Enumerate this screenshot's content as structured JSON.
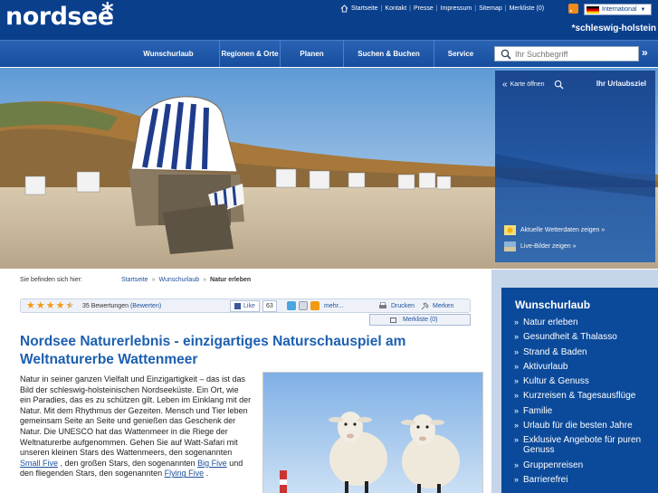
{
  "header": {
    "logo": "nordsee",
    "logo_star": "*",
    "tagline": "*schleswig-holstein",
    "top_links": [
      "Startseite",
      "Kontakt",
      "Presse",
      "Impressum",
      "Sitemap",
      "Merkliste (0)"
    ],
    "international": "International"
  },
  "nav": {
    "items": [
      "Wunschurlaub",
      "Regionen & Orte",
      "Planen",
      "Suchen & Buchen",
      "Service"
    ],
    "search_placeholder": "Ihr Suchbegriff",
    "search_go": "»"
  },
  "map_panel": {
    "open": "Karte öffnen",
    "title": "Ihr Urlaubsziel",
    "weather": "Aktuelle Wetterdaten zeigen »",
    "live": "Live-Bilder zeigen »"
  },
  "breadcrumb": {
    "label": "Sie befinden sich hier:",
    "items": [
      "Startseite",
      "Wunschurlaub"
    ],
    "current": "Natur erleben"
  },
  "toolbar": {
    "rating": 4.5,
    "ratings_text": "35 Bewertungen",
    "rate_link": "(Bewerten)",
    "like": "Like",
    "like_count": "63",
    "more": "mehr...",
    "print": "Drucken",
    "merken": "Merken",
    "merkliste": "Merkliste (0)"
  },
  "article": {
    "title": "Nordsee Naturerlebnis - einzigartiges Naturschauspiel am Weltnaturerbe Wattenmeer",
    "p1": "Natur in seiner ganzen Vielfalt und Einzigartigkeit – das ist das Bild der schleswig-holsteinischen Nordseeküste. Ein Ort, wie ein Paradies, das es zu schützen gilt. Leben im Einklang mit der Natur. Mit dem Rhythmus der Gezeiten. Mensch und Tier leben gemeinsam Seite an Seite und genießen das Geschenk der Natur. Die UNESCO hat das Wattenmeer in die Riege der Weltnaturerbe aufgenommen. Gehen Sie auf Watt-Safari mit unseren kleinen Stars des Wattenmeers, den sogenannten",
    "link1": "Small Five",
    "p2": ", den großen Stars, den sogenannten",
    "link2": "Big Five",
    "p3": "und den fliegenden Stars, den sogenannten",
    "link3": "Flying Five",
    "p4": "."
  },
  "sidebar": {
    "title": "Wunschurlaub",
    "items": [
      "Natur erleben",
      "Gesundheit & Thalasso",
      "Strand & Baden",
      "Aktivurlaub",
      "Kultur & Genuss",
      "Kurzreisen & Tagesausflüge",
      "Familie",
      "Urlaub für die besten Jahre",
      "Exklusive Angebote für puren Genuss",
      "Gruppenreisen",
      "Barrierefrei"
    ]
  },
  "colors": {
    "brand": "#0a3f8c",
    "link": "#1d4f9c",
    "title": "#1d5fb0",
    "star": "#f29a11"
  }
}
